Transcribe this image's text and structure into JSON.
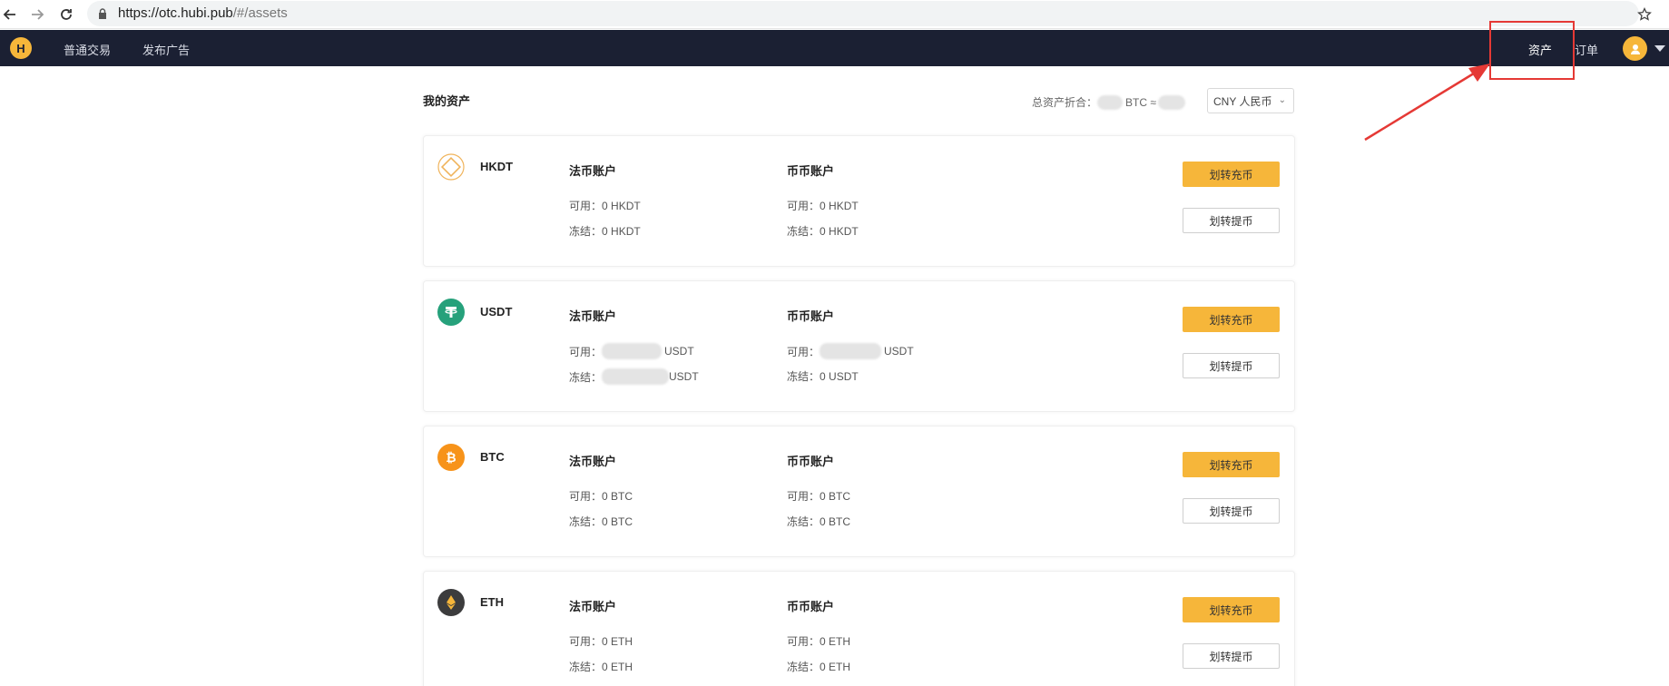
{
  "browser": {
    "url_main": "https://otc.hubi.pub",
    "url_path": "/#/assets"
  },
  "topnav": {
    "logo_letter": "H",
    "links": [
      "普通交易",
      "发布广告"
    ],
    "right_links": [
      "资产",
      "订单"
    ]
  },
  "page": {
    "title": "我的资产",
    "total_label": "总资产折合：",
    "total_btc_unit": "BTC ≈",
    "currency": "CNY 人民币"
  },
  "labels": {
    "fiat_account": "法币账户",
    "coin_account": "币币账户",
    "available": "可用：",
    "frozen": "冻结：",
    "transfer_deposit": "划转充币",
    "transfer_withdraw": "划转提币"
  },
  "assets": [
    {
      "symbol": "HKDT",
      "fiat_available": "0 HKDT",
      "fiat_frozen": "0 HKDT",
      "coin_available": "0 HKDT",
      "coin_frozen": "0 HKDT"
    },
    {
      "symbol": "USDT",
      "fiat_available": "USDT",
      "fiat_frozen": "USDT",
      "coin_available": "USDT",
      "coin_frozen": "0 USDT"
    },
    {
      "symbol": "BTC",
      "fiat_available": "0 BTC",
      "fiat_frozen": "0 BTC",
      "coin_available": "0 BTC",
      "coin_frozen": "0 BTC"
    },
    {
      "symbol": "ETH",
      "fiat_available": "0 ETH",
      "fiat_frozen": "0 ETH",
      "coin_available": "0 ETH",
      "coin_frozen": "0 ETH"
    }
  ],
  "colors": {
    "nav_bg": "#1b2033",
    "accent": "#f6b63a",
    "usdt": "#26a17b",
    "btc": "#f7931a",
    "eth": "#3c3c3d",
    "annotation": "#e53935"
  },
  "icons": {
    "hkdt": "hkdt-diamond-icon",
    "usdt": "tether-icon",
    "btc": "bitcoin-icon",
    "eth": "ethereum-icon"
  }
}
